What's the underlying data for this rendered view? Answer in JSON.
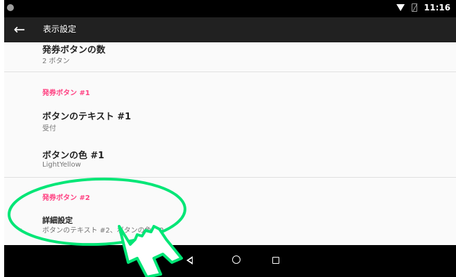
{
  "statusbar": {
    "time": "11:16",
    "wifi_icon": "wifi-icon",
    "sim_icon": "no-sim-icon"
  },
  "appbar": {
    "title": "表示設定",
    "back_icon": "back-arrow-icon"
  },
  "list": {
    "ticket_count": {
      "title": "発券ボタンの数",
      "summary": "2 ボタン"
    },
    "category1": {
      "header": "発券ボタン #1"
    },
    "button_text1": {
      "title": "ボタンのテキスト #1",
      "summary": "受付"
    },
    "button_color1": {
      "title": "ボタンの色 #1",
      "summary": "LightYellow"
    },
    "category2": {
      "header": "発券ボタン #2"
    },
    "advanced": {
      "title": "詳細設定",
      "summary": "ボタンのテキスト #2、ボタンの色 #2"
    }
  },
  "navbar": {
    "back_icon": "nav-back-icon",
    "home_icon": "nav-home-icon",
    "recents_icon": "nav-recents-icon"
  },
  "annotation": {
    "color": "#00e676"
  },
  "colors": {
    "accent": "#ff4081",
    "appbar": "#212121"
  }
}
